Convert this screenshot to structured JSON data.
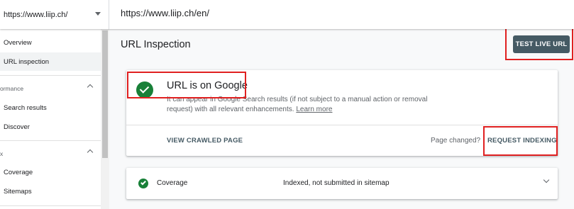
{
  "header": {
    "property": "https://www.liip.ch/",
    "inspected_url": "https://www.liip.ch/en/"
  },
  "sidebar": {
    "items": [
      {
        "label": "Overview"
      },
      {
        "label": "URL inspection",
        "active": true
      }
    ],
    "sections": [
      {
        "label": "ormance",
        "items": [
          {
            "label": "Search results"
          },
          {
            "label": "Discover"
          }
        ]
      },
      {
        "label": "x",
        "items": [
          {
            "label": "Coverage"
          },
          {
            "label": "Sitemaps"
          }
        ]
      }
    ]
  },
  "main": {
    "title": "URL Inspection",
    "test_live_label": "TEST LIVE URL",
    "status": {
      "title": "URL is on Google",
      "description": "It can appear in Google Search results (if not subject to a manual action or removal request) with all relevant enhancements.",
      "learn_more": "Learn more",
      "view_crawled": "VIEW CRAWLED PAGE",
      "page_changed": "Page changed?",
      "request_indexing": "REQUEST INDEXING"
    },
    "coverage": {
      "label": "Coverage",
      "value": "Indexed, not submitted in sitemap"
    }
  },
  "colors": {
    "accent": "#455a64",
    "success": "#188038",
    "highlight": "#e02020"
  }
}
